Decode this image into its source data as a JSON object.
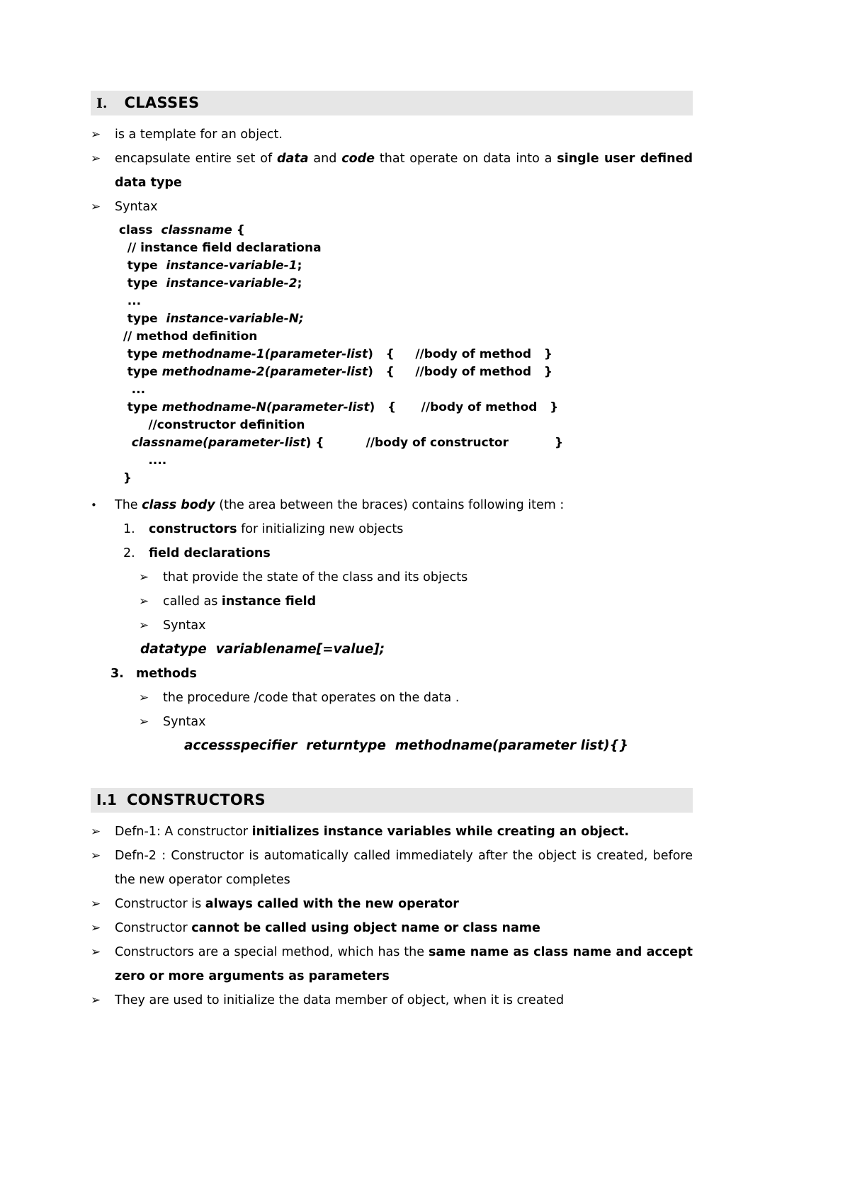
{
  "document": {
    "sections": [
      {
        "id": "classes",
        "number": "I.",
        "title": "CLASSES"
      },
      {
        "id": "constructors",
        "number": "I.1",
        "title": "CONSTRUCTORS"
      }
    ]
  },
  "markers": {
    "arrow": "➢",
    "dot": "•"
  },
  "classes": {
    "bullets": [
      {
        "text": "is a template for an object."
      },
      {
        "text_pre": "encapsulate entire set of ",
        "bi1": "data",
        "mid1": " and ",
        "bi2": "code",
        "mid2": " that operate on data into a ",
        "b1": "single user defined data type"
      },
      {
        "text": "Syntax"
      }
    ],
    "code": {
      "lines": [
        {
          "pre": " class  ",
          "italic": "classname",
          "post": " {"
        },
        {
          "pre": "   // instance field declarationa",
          "italic": "",
          "post": ""
        },
        {
          "pre": "   type  ",
          "italic": "instance-variable-1",
          "post": ";"
        },
        {
          "pre": "   type  ",
          "italic": "instance-variable-2",
          "post": ";"
        },
        {
          "pre": "   ...",
          "italic": "",
          "post": ""
        },
        {
          "pre": "   type  ",
          "italic": "instance-variable-N;",
          "post": ""
        },
        {
          "pre": "  // method definition",
          "italic": "",
          "post": ""
        },
        {
          "pre": "   type ",
          "italic": "methodname-1(parameter-list",
          "post": ")   {     //body of method   }"
        },
        {
          "pre": "   type ",
          "italic": "methodname-2(parameter-list",
          "post": ")   {     //body of method   }"
        },
        {
          "pre": "    ...",
          "italic": "",
          "post": ""
        },
        {
          "pre": "   type ",
          "italic": "methodname-N(parameter-list",
          "post": ")   {      //body of method   }"
        },
        {
          "pre": "        //constructor definition",
          "italic": "",
          "post": ""
        },
        {
          "pre": "    ",
          "italic": "classname(parameter-list",
          "post": ") {          //body of constructor           }"
        },
        {
          "pre": "        ....",
          "italic": "",
          "post": ""
        },
        {
          "pre": "  }",
          "italic": "",
          "post": ""
        }
      ]
    },
    "class_body": {
      "lead_pre": "The ",
      "lead_bi": "class body",
      "lead_post": " (the area between the braces) contains following item :",
      "items": [
        {
          "num": "1.",
          "bold": "constructors",
          "rest": " for initializing new objects",
          "subitems": []
        },
        {
          "num": "2.",
          "bold": "field declarations",
          "rest": "",
          "subitems": [
            {
              "text": "that provide the state of the class and its objects"
            },
            {
              "pre": "called as ",
              "bold": "instance field"
            },
            {
              "text": "Syntax"
            }
          ],
          "syntax": "datatype  variablename[=value];"
        },
        {
          "num": "3.",
          "bold": "methods",
          "rest": "",
          "subitems": [
            {
              "text": "the procedure /code that operates on the data ."
            },
            {
              "text": "Syntax"
            }
          ],
          "syntax": "accessspecifier  returntype  methodname(parameter list){}"
        }
      ]
    }
  },
  "constructors": {
    "bullets": [
      {
        "pre": "Defn-1:  A constructor ",
        "bold": "initializes instance variables while creating an object.",
        "post": ""
      },
      {
        "pre": "Defn-2 : Constructor is automatically called immediately after the object is created, before the new operator completes",
        "bold": "",
        "post": ""
      },
      {
        "pre": "Constructor is ",
        "bold": "always called with the new operator",
        "post": ""
      },
      {
        "pre": "Constructor ",
        "bold": "cannot be called using object name or class name",
        "post": ""
      },
      {
        "pre": "Constructors are a special method, which has the ",
        "bold": "same name as class name and accept zero or more arguments as parameters",
        "post": ""
      },
      {
        "pre": "They are used to initialize the data member of object, when it is created",
        "bold": "",
        "post": ""
      }
    ]
  }
}
